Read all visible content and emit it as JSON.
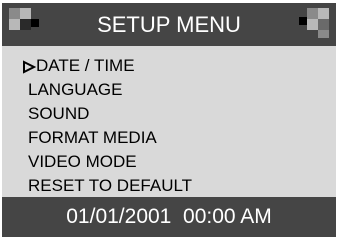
{
  "header": {
    "title": "SETUP MENU",
    "left_icon": "checker-pattern-icon",
    "right_icon": "checker-pattern-icon"
  },
  "menu": {
    "selected_index": 0,
    "cursor_icon": "triangle-right-outline-icon",
    "items": [
      {
        "label": "DATE / TIME"
      },
      {
        "label": "LANGUAGE"
      },
      {
        "label": "SOUND"
      },
      {
        "label": "FORMAT MEDIA"
      },
      {
        "label": "VIDEO MODE"
      },
      {
        "label": "RESET TO DEFAULT"
      }
    ]
  },
  "footer": {
    "datetime": "01/01/2001  00:00 AM"
  },
  "colors": {
    "bar": "#454545",
    "panel": "#d9d9d9",
    "bar_text": "#ffffff",
    "menu_text": "#000000"
  }
}
